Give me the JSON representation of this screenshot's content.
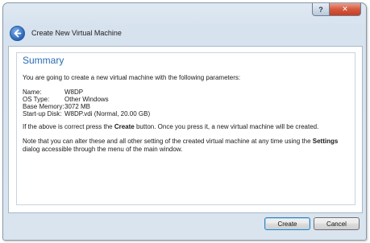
{
  "window": {
    "title": "Create New Virtual Machine",
    "caption_help": "?",
    "caption_close": "✕"
  },
  "summary": {
    "heading": "Summary",
    "intro": "You are going to create a new virtual machine with the following parameters:",
    "params": [
      {
        "label": "Name:",
        "value": "W8DP"
      },
      {
        "label": "OS Type:",
        "value": "Other Windows"
      },
      {
        "label": "Base Memory:",
        "value": "3072 MB"
      },
      {
        "label": "Start-up Disk:",
        "value": "W8DP.vdi (Normal, 20.00 GB)"
      }
    ],
    "confirm_before": "If the above is correct press the ",
    "confirm_bold": "Create",
    "confirm_after": " button. Once you press it, a new virtual machine will be created.",
    "note_before": "Note that you can alter these and all other setting of the created virtual machine at any time using the ",
    "note_bold": "Settings",
    "note_after": " dialog accessible through the menu of the main window."
  },
  "buttons": {
    "create": "Create",
    "cancel": "Cancel"
  },
  "colors": {
    "heading": "#2b6bb5",
    "close_button": "#c63f22"
  },
  "icons": {
    "back": "back-arrow-icon",
    "close": "close-icon",
    "help": "help-icon"
  }
}
